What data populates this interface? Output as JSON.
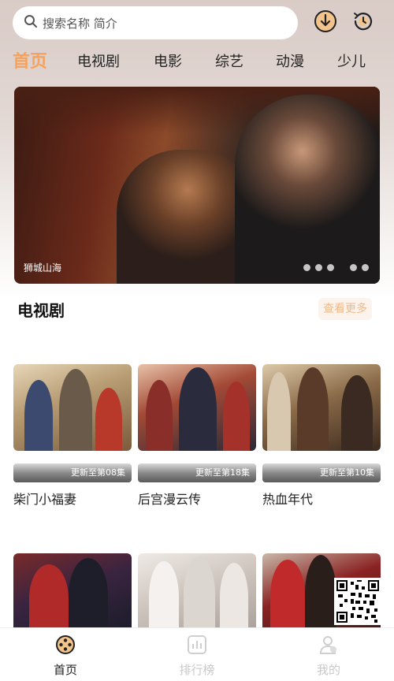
{
  "search": {
    "placeholder": "搜索名称 简介"
  },
  "header_icons": [
    "download-icon",
    "history-icon"
  ],
  "tabs": [
    {
      "label": "首页",
      "active": true
    },
    {
      "label": "电视剧",
      "active": false
    },
    {
      "label": "电影",
      "active": false
    },
    {
      "label": "综艺",
      "active": false
    },
    {
      "label": "动漫",
      "active": false
    },
    {
      "label": "少儿",
      "active": false
    }
  ],
  "banner": {
    "caption": "狮城山海",
    "slide_count": 5
  },
  "section": {
    "title": "电视剧",
    "more_label": "查看更多"
  },
  "cards": [
    {
      "title": "柴门小福妻",
      "update": "更新至第08集"
    },
    {
      "title": "后宫漫云传",
      "update": "更新至第18集"
    },
    {
      "title": "热血年代",
      "update": "更新至第10集"
    }
  ],
  "cards_row2_count": 3,
  "bottom_nav": [
    {
      "label": "首页",
      "icon": "film-reel-icon",
      "active": true
    },
    {
      "label": "排行榜",
      "icon": "chart-icon",
      "active": false
    },
    {
      "label": "我的",
      "icon": "profile-icon",
      "active": false
    }
  ],
  "colors": {
    "accent": "#f5a25e",
    "more_text": "#f2b98a"
  }
}
